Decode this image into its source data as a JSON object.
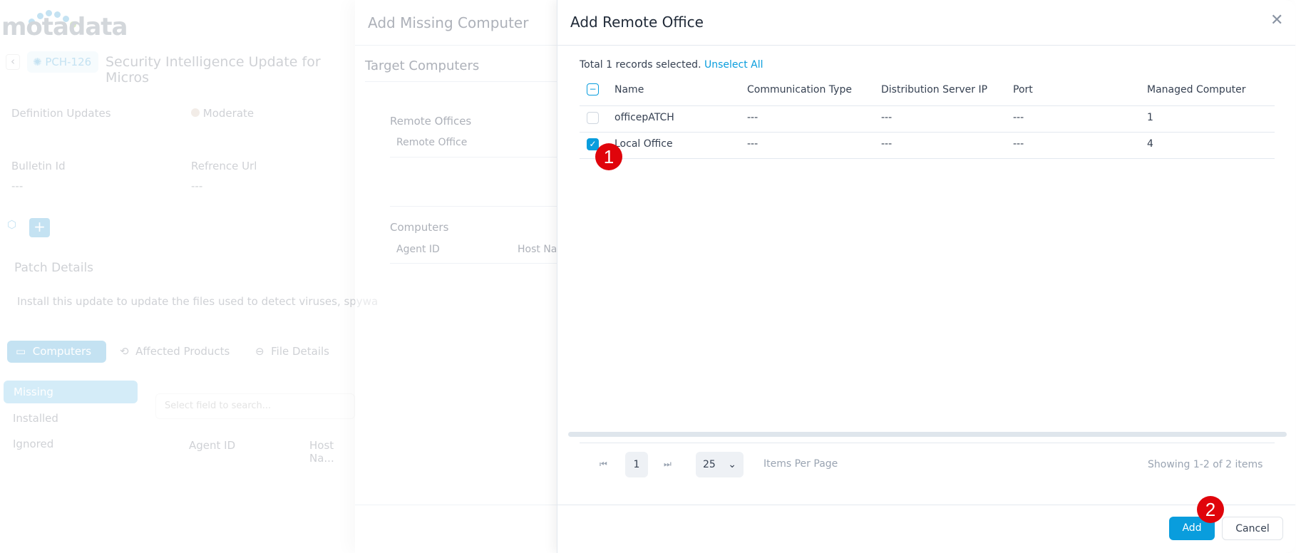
{
  "background": {
    "logo": "motadata",
    "ticket_id": "PCH-126",
    "ticket_title": "Security Intelligence Update for Micros",
    "category": "Definition Updates",
    "severity": "Moderate",
    "bulletin_label": "Bulletin Id",
    "bulletin_value": "---",
    "ref_label": "Refrence Url",
    "ref_value": "---",
    "patch_details_title": "Patch Details",
    "patch_description": "Install this update to update the files used to detect viruses, spywa",
    "tabs": [
      {
        "label": "Computers"
      },
      {
        "label": "Affected Products"
      },
      {
        "label": "File Details"
      }
    ],
    "subtabs": [
      {
        "label": "Missing"
      },
      {
        "label": "Installed"
      },
      {
        "label": "Ignored"
      }
    ],
    "search_placeholder": "Select field to search...",
    "cols": [
      "Agent ID",
      "Host Na..."
    ]
  },
  "middle": {
    "title": "Add Missing Computer",
    "section": "Target Computers",
    "remote_offices_label": "Remote Offices",
    "remote_office_col": "Remote Office",
    "computers_label": "Computers",
    "cols": [
      "Agent ID",
      "Host Nar"
    ]
  },
  "dialog": {
    "title": "Add Remote Office",
    "selection_text": "Total 1 records selected.",
    "unselect_all": "Unselect All",
    "columns": [
      "Name",
      "Communication Type",
      "Distribution Server IP",
      "Port",
      "Managed Computer"
    ],
    "rows": [
      {
        "name": "officepATCH",
        "comm": "---",
        "ip": "---",
        "port": "---",
        "managed": "1",
        "checked": false
      },
      {
        "name": "Local Office",
        "comm": "---",
        "ip": "---",
        "port": "---",
        "managed": "4",
        "checked": true
      }
    ],
    "pager": {
      "page": "1",
      "per_page": "25",
      "per_page_label": "Items Per Page",
      "showing": "Showing 1-2 of 2 items"
    },
    "add_label": "Add",
    "cancel_label": "Cancel",
    "accent": "#099ddd"
  },
  "annotations": [
    "1",
    "2"
  ]
}
